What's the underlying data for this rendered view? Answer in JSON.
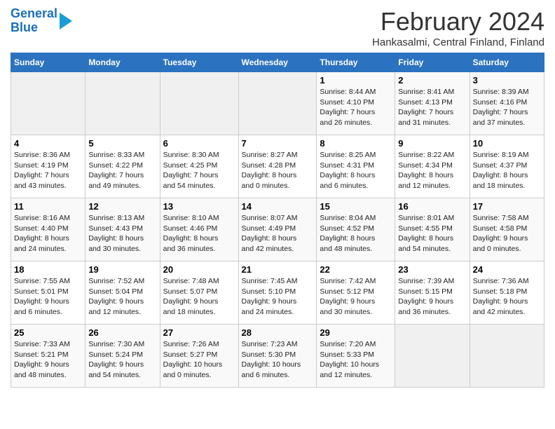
{
  "header": {
    "logo_line1": "General",
    "logo_line2": "Blue",
    "title": "February 2024",
    "subtitle": "Hankasalmi, Central Finland, Finland"
  },
  "days_of_week": [
    "Sunday",
    "Monday",
    "Tuesday",
    "Wednesday",
    "Thursday",
    "Friday",
    "Saturday"
  ],
  "weeks": [
    [
      {
        "day": "",
        "content": ""
      },
      {
        "day": "",
        "content": ""
      },
      {
        "day": "",
        "content": ""
      },
      {
        "day": "",
        "content": ""
      },
      {
        "day": "1",
        "content": "Sunrise: 8:44 AM\nSunset: 4:10 PM\nDaylight: 7 hours\nand 26 minutes."
      },
      {
        "day": "2",
        "content": "Sunrise: 8:41 AM\nSunset: 4:13 PM\nDaylight: 7 hours\nand 31 minutes."
      },
      {
        "day": "3",
        "content": "Sunrise: 8:39 AM\nSunset: 4:16 PM\nDaylight: 7 hours\nand 37 minutes."
      }
    ],
    [
      {
        "day": "4",
        "content": "Sunrise: 8:36 AM\nSunset: 4:19 PM\nDaylight: 7 hours\nand 43 minutes."
      },
      {
        "day": "5",
        "content": "Sunrise: 8:33 AM\nSunset: 4:22 PM\nDaylight: 7 hours\nand 49 minutes."
      },
      {
        "day": "6",
        "content": "Sunrise: 8:30 AM\nSunset: 4:25 PM\nDaylight: 7 hours\nand 54 minutes."
      },
      {
        "day": "7",
        "content": "Sunrise: 8:27 AM\nSunset: 4:28 PM\nDaylight: 8 hours\nand 0 minutes."
      },
      {
        "day": "8",
        "content": "Sunrise: 8:25 AM\nSunset: 4:31 PM\nDaylight: 8 hours\nand 6 minutes."
      },
      {
        "day": "9",
        "content": "Sunrise: 8:22 AM\nSunset: 4:34 PM\nDaylight: 8 hours\nand 12 minutes."
      },
      {
        "day": "10",
        "content": "Sunrise: 8:19 AM\nSunset: 4:37 PM\nDaylight: 8 hours\nand 18 minutes."
      }
    ],
    [
      {
        "day": "11",
        "content": "Sunrise: 8:16 AM\nSunset: 4:40 PM\nDaylight: 8 hours\nand 24 minutes."
      },
      {
        "day": "12",
        "content": "Sunrise: 8:13 AM\nSunset: 4:43 PM\nDaylight: 8 hours\nand 30 minutes."
      },
      {
        "day": "13",
        "content": "Sunrise: 8:10 AM\nSunset: 4:46 PM\nDaylight: 8 hours\nand 36 minutes."
      },
      {
        "day": "14",
        "content": "Sunrise: 8:07 AM\nSunset: 4:49 PM\nDaylight: 8 hours\nand 42 minutes."
      },
      {
        "day": "15",
        "content": "Sunrise: 8:04 AM\nSunset: 4:52 PM\nDaylight: 8 hours\nand 48 minutes."
      },
      {
        "day": "16",
        "content": "Sunrise: 8:01 AM\nSunset: 4:55 PM\nDaylight: 8 hours\nand 54 minutes."
      },
      {
        "day": "17",
        "content": "Sunrise: 7:58 AM\nSunset: 4:58 PM\nDaylight: 9 hours\nand 0 minutes."
      }
    ],
    [
      {
        "day": "18",
        "content": "Sunrise: 7:55 AM\nSunset: 5:01 PM\nDaylight: 9 hours\nand 6 minutes."
      },
      {
        "day": "19",
        "content": "Sunrise: 7:52 AM\nSunset: 5:04 PM\nDaylight: 9 hours\nand 12 minutes."
      },
      {
        "day": "20",
        "content": "Sunrise: 7:48 AM\nSunset: 5:07 PM\nDaylight: 9 hours\nand 18 minutes."
      },
      {
        "day": "21",
        "content": "Sunrise: 7:45 AM\nSunset: 5:10 PM\nDaylight: 9 hours\nand 24 minutes."
      },
      {
        "day": "22",
        "content": "Sunrise: 7:42 AM\nSunset: 5:12 PM\nDaylight: 9 hours\nand 30 minutes."
      },
      {
        "day": "23",
        "content": "Sunrise: 7:39 AM\nSunset: 5:15 PM\nDaylight: 9 hours\nand 36 minutes."
      },
      {
        "day": "24",
        "content": "Sunrise: 7:36 AM\nSunset: 5:18 PM\nDaylight: 9 hours\nand 42 minutes."
      }
    ],
    [
      {
        "day": "25",
        "content": "Sunrise: 7:33 AM\nSunset: 5:21 PM\nDaylight: 9 hours\nand 48 minutes."
      },
      {
        "day": "26",
        "content": "Sunrise: 7:30 AM\nSunset: 5:24 PM\nDaylight: 9 hours\nand 54 minutes."
      },
      {
        "day": "27",
        "content": "Sunrise: 7:26 AM\nSunset: 5:27 PM\nDaylight: 10 hours\nand 0 minutes."
      },
      {
        "day": "28",
        "content": "Sunrise: 7:23 AM\nSunset: 5:30 PM\nDaylight: 10 hours\nand 6 minutes."
      },
      {
        "day": "29",
        "content": "Sunrise: 7:20 AM\nSunset: 5:33 PM\nDaylight: 10 hours\nand 12 minutes."
      },
      {
        "day": "",
        "content": ""
      },
      {
        "day": "",
        "content": ""
      }
    ]
  ]
}
